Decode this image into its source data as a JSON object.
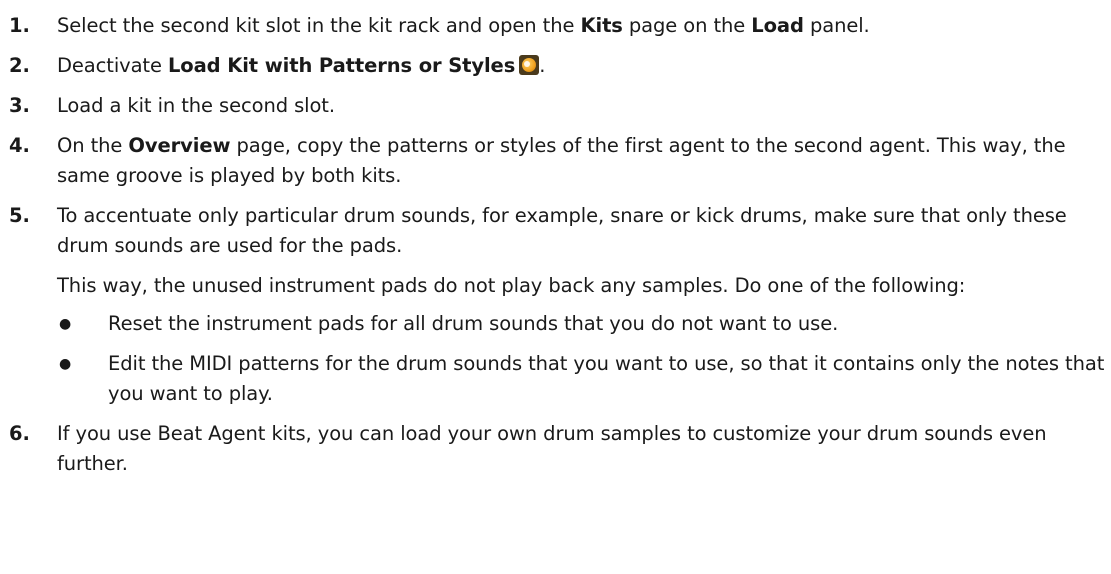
{
  "steps": [
    {
      "number": "1.",
      "parts": [
        "Select the second kit slot in the kit rack and open the ",
        "Kits",
        " page on the ",
        "Load",
        " panel."
      ]
    },
    {
      "number": "2.",
      "parts": [
        "Deactivate ",
        "Load Kit with Patterns or Styles",
        "."
      ],
      "icon": "load-kit-toggle-icon"
    },
    {
      "number": "3.",
      "parts": [
        "Load a kit in the second slot."
      ]
    },
    {
      "number": "4.",
      "parts": [
        "On the ",
        "Overview",
        " page, copy the patterns or styles of the first agent to the second agent. This way, the same groove is played by both kits."
      ]
    },
    {
      "number": "5.",
      "parts": [
        "To accentuate only particular drum sounds, for example, snare or kick drums, make sure that only these drum sounds are used for the pads."
      ],
      "sub_para": "This way, the unused instrument pads do not play back any samples. Do one of the following:",
      "bullets": [
        "Reset the instrument pads for all drum sounds that you do not want to use.",
        "Edit the MIDI patterns for the drum sounds that you want to use, so that it contains only the notes that you want to play."
      ]
    },
    {
      "number": "6.",
      "parts": [
        "If you use Beat Agent kits, you can load your own drum samples to customize your drum sounds even further."
      ]
    }
  ],
  "bullet_glyph": "●"
}
